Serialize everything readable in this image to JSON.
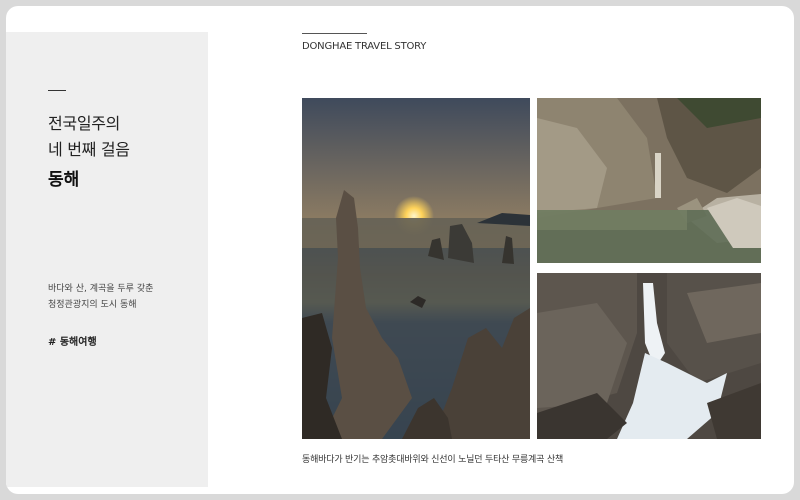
{
  "sidebar": {
    "title_line1": "전국일주의",
    "title_line2": "네 번째 걸음",
    "title_bold": "동해",
    "desc_line1": "바다와 산, 계곡을 두루 갖춘",
    "desc_line2": "청정관광지의 도시 동해",
    "hashtag": "# 동해여행"
  },
  "main": {
    "heading": "DONGHAE TRAVEL STORY",
    "photos": [
      {
        "name": "sunrise-rock-coast",
        "subject": "sunrise over sea with rock pillars"
      },
      {
        "name": "mountain-valley-pool",
        "subject": "rocky gorge with clear pool"
      },
      {
        "name": "waterfall",
        "subject": "waterfall between rocks"
      }
    ],
    "caption": "동해바다가 반기는 추암촛대바위와 신선이 노닐던 두타산 무릉계곡 산책"
  }
}
